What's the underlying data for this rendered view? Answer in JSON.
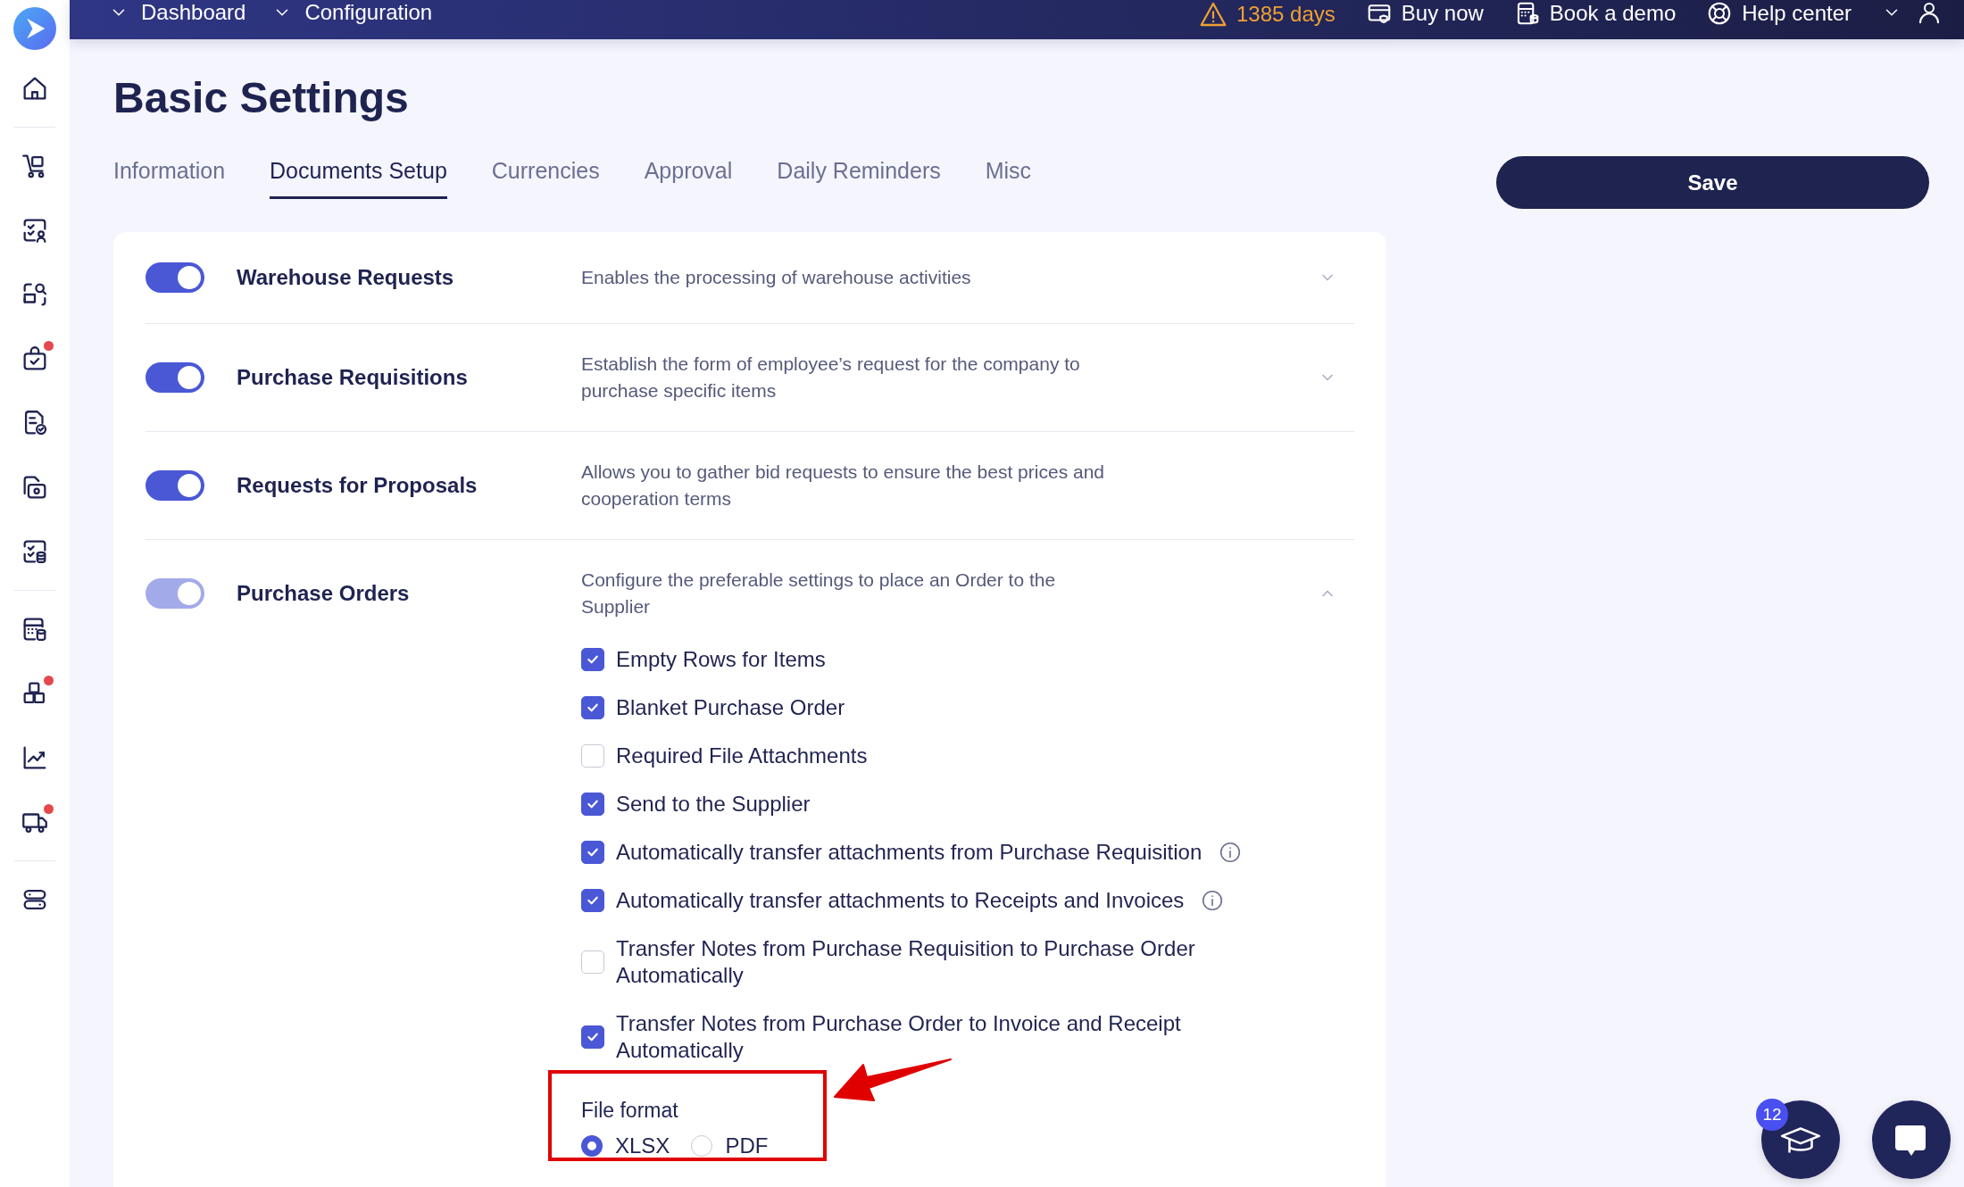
{
  "topbar": {
    "breadcrumbs": [
      "Dashboard",
      "Configuration"
    ],
    "trial": "1385 days",
    "links": [
      {
        "label": "Buy now"
      },
      {
        "label": "Book a demo"
      },
      {
        "label": "Help center"
      }
    ]
  },
  "sidebar": {
    "groups": [
      [
        {
          "dot": false
        }
      ],
      [
        {
          "dot": false
        },
        {
          "dot": false
        },
        {
          "dot": false
        },
        {
          "dot": true
        },
        {
          "dot": false
        },
        {
          "dot": false
        },
        {
          "dot": false
        }
      ],
      [
        {
          "dot": false
        },
        {
          "dot": true
        },
        {
          "dot": false
        },
        {
          "dot": true
        }
      ],
      [
        {
          "dot": false
        }
      ]
    ]
  },
  "page": {
    "title": "Basic Settings"
  },
  "tabs": [
    {
      "label": "Information",
      "selected": false
    },
    {
      "label": "Documents Setup",
      "selected": true
    },
    {
      "label": "Currencies",
      "selected": false
    },
    {
      "label": "Approval",
      "selected": false
    },
    {
      "label": "Daily Reminders",
      "selected": false
    },
    {
      "label": "Misc",
      "selected": false
    }
  ],
  "save_button": "Save",
  "modules": [
    {
      "name": "Warehouse Requests",
      "description": "Enables the processing of warehouse activities",
      "on": true,
      "disabled": false,
      "expandable": true,
      "expanded": false
    },
    {
      "name": "Purchase Requisitions",
      "description": "Establish the form of employee’s request for the company to purchase specific items",
      "on": true,
      "disabled": false,
      "expandable": true,
      "expanded": false
    },
    {
      "name": "Requests for Proposals",
      "description": "Allows you to gather bid requests to ensure the best prices and cooperation terms",
      "on": true,
      "disabled": false,
      "expandable": false,
      "expanded": false
    },
    {
      "name": "Purchase Orders",
      "description": "Configure the preferable settings to place an Order to the Supplier",
      "on": true,
      "disabled": true,
      "expandable": true,
      "expanded": true
    }
  ],
  "order_options": [
    {
      "label": "Empty Rows for Items",
      "checked": true,
      "info": false
    },
    {
      "label": "Blanket Purchase Order",
      "checked": true,
      "info": false
    },
    {
      "label": "Required File Attachments",
      "checked": false,
      "info": false
    },
    {
      "label": "Send to the Supplier",
      "checked": true,
      "info": false
    },
    {
      "label": "Automatically transfer attachments from Purchase Requisition",
      "checked": true,
      "info": true
    },
    {
      "label": "Automatically transfer attachments to Receipts and Invoices",
      "checked": true,
      "info": true
    },
    {
      "label": "Transfer Notes from Purchase Requisition to Purchase Order Automatically",
      "checked": false,
      "info": false
    },
    {
      "label": "Transfer Notes from Purchase Order to Invoice and Receipt Automatically",
      "checked": true,
      "info": false
    }
  ],
  "file_format": {
    "label": "File format",
    "options": [
      {
        "label": "XLSX",
        "selected": true
      },
      {
        "label": "PDF",
        "selected": false
      }
    ]
  },
  "academy": {
    "badge": "12"
  }
}
